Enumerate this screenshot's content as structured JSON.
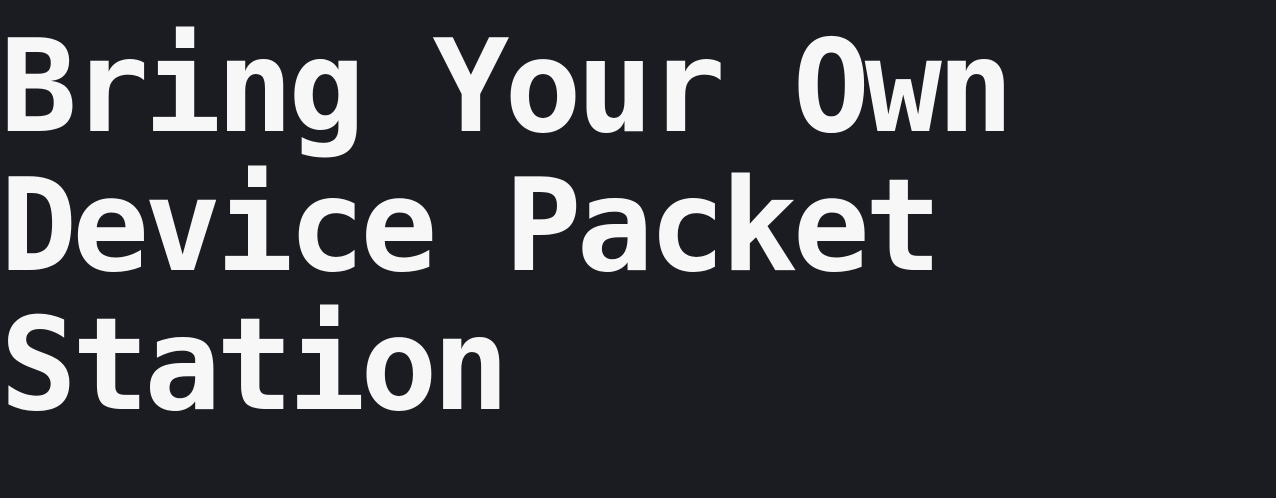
{
  "heading": {
    "lines": [
      "Bring Your Own",
      "Device Packet",
      "Station"
    ]
  },
  "colors": {
    "background": "#1b1c21",
    "text": "#f7f7f8"
  }
}
